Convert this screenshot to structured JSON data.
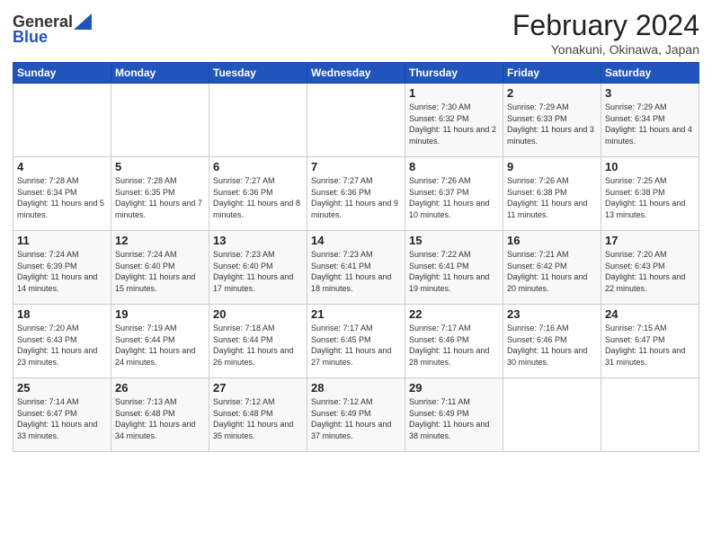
{
  "header": {
    "logo_general": "General",
    "logo_blue": "Blue",
    "title": "February 2024",
    "subtitle": "Yonakuni, Okinawa, Japan"
  },
  "weekdays": [
    "Sunday",
    "Monday",
    "Tuesday",
    "Wednesday",
    "Thursday",
    "Friday",
    "Saturday"
  ],
  "weeks": [
    [
      {
        "day": "",
        "sunrise": "",
        "sunset": "",
        "daylight": ""
      },
      {
        "day": "",
        "sunrise": "",
        "sunset": "",
        "daylight": ""
      },
      {
        "day": "",
        "sunrise": "",
        "sunset": "",
        "daylight": ""
      },
      {
        "day": "",
        "sunrise": "",
        "sunset": "",
        "daylight": ""
      },
      {
        "day": "1",
        "sunrise": "Sunrise: 7:30 AM",
        "sunset": "Sunset: 6:32 PM",
        "daylight": "Daylight: 11 hours and 2 minutes."
      },
      {
        "day": "2",
        "sunrise": "Sunrise: 7:29 AM",
        "sunset": "Sunset: 6:33 PM",
        "daylight": "Daylight: 11 hours and 3 minutes."
      },
      {
        "day": "3",
        "sunrise": "Sunrise: 7:29 AM",
        "sunset": "Sunset: 6:34 PM",
        "daylight": "Daylight: 11 hours and 4 minutes."
      }
    ],
    [
      {
        "day": "4",
        "sunrise": "Sunrise: 7:28 AM",
        "sunset": "Sunset: 6:34 PM",
        "daylight": "Daylight: 11 hours and 5 minutes."
      },
      {
        "day": "5",
        "sunrise": "Sunrise: 7:28 AM",
        "sunset": "Sunset: 6:35 PM",
        "daylight": "Daylight: 11 hours and 7 minutes."
      },
      {
        "day": "6",
        "sunrise": "Sunrise: 7:27 AM",
        "sunset": "Sunset: 6:36 PM",
        "daylight": "Daylight: 11 hours and 8 minutes."
      },
      {
        "day": "7",
        "sunrise": "Sunrise: 7:27 AM",
        "sunset": "Sunset: 6:36 PM",
        "daylight": "Daylight: 11 hours and 9 minutes."
      },
      {
        "day": "8",
        "sunrise": "Sunrise: 7:26 AM",
        "sunset": "Sunset: 6:37 PM",
        "daylight": "Daylight: 11 hours and 10 minutes."
      },
      {
        "day": "9",
        "sunrise": "Sunrise: 7:26 AM",
        "sunset": "Sunset: 6:38 PM",
        "daylight": "Daylight: 11 hours and 11 minutes."
      },
      {
        "day": "10",
        "sunrise": "Sunrise: 7:25 AM",
        "sunset": "Sunset: 6:38 PM",
        "daylight": "Daylight: 11 hours and 13 minutes."
      }
    ],
    [
      {
        "day": "11",
        "sunrise": "Sunrise: 7:24 AM",
        "sunset": "Sunset: 6:39 PM",
        "daylight": "Daylight: 11 hours and 14 minutes."
      },
      {
        "day": "12",
        "sunrise": "Sunrise: 7:24 AM",
        "sunset": "Sunset: 6:40 PM",
        "daylight": "Daylight: 11 hours and 15 minutes."
      },
      {
        "day": "13",
        "sunrise": "Sunrise: 7:23 AM",
        "sunset": "Sunset: 6:40 PM",
        "daylight": "Daylight: 11 hours and 17 minutes."
      },
      {
        "day": "14",
        "sunrise": "Sunrise: 7:23 AM",
        "sunset": "Sunset: 6:41 PM",
        "daylight": "Daylight: 11 hours and 18 minutes."
      },
      {
        "day": "15",
        "sunrise": "Sunrise: 7:22 AM",
        "sunset": "Sunset: 6:41 PM",
        "daylight": "Daylight: 11 hours and 19 minutes."
      },
      {
        "day": "16",
        "sunrise": "Sunrise: 7:21 AM",
        "sunset": "Sunset: 6:42 PM",
        "daylight": "Daylight: 11 hours and 20 minutes."
      },
      {
        "day": "17",
        "sunrise": "Sunrise: 7:20 AM",
        "sunset": "Sunset: 6:43 PM",
        "daylight": "Daylight: 11 hours and 22 minutes."
      }
    ],
    [
      {
        "day": "18",
        "sunrise": "Sunrise: 7:20 AM",
        "sunset": "Sunset: 6:43 PM",
        "daylight": "Daylight: 11 hours and 23 minutes."
      },
      {
        "day": "19",
        "sunrise": "Sunrise: 7:19 AM",
        "sunset": "Sunset: 6:44 PM",
        "daylight": "Daylight: 11 hours and 24 minutes."
      },
      {
        "day": "20",
        "sunrise": "Sunrise: 7:18 AM",
        "sunset": "Sunset: 6:44 PM",
        "daylight": "Daylight: 11 hours and 26 minutes."
      },
      {
        "day": "21",
        "sunrise": "Sunrise: 7:17 AM",
        "sunset": "Sunset: 6:45 PM",
        "daylight": "Daylight: 11 hours and 27 minutes."
      },
      {
        "day": "22",
        "sunrise": "Sunrise: 7:17 AM",
        "sunset": "Sunset: 6:46 PM",
        "daylight": "Daylight: 11 hours and 28 minutes."
      },
      {
        "day": "23",
        "sunrise": "Sunrise: 7:16 AM",
        "sunset": "Sunset: 6:46 PM",
        "daylight": "Daylight: 11 hours and 30 minutes."
      },
      {
        "day": "24",
        "sunrise": "Sunrise: 7:15 AM",
        "sunset": "Sunset: 6:47 PM",
        "daylight": "Daylight: 11 hours and 31 minutes."
      }
    ],
    [
      {
        "day": "25",
        "sunrise": "Sunrise: 7:14 AM",
        "sunset": "Sunset: 6:47 PM",
        "daylight": "Daylight: 11 hours and 33 minutes."
      },
      {
        "day": "26",
        "sunrise": "Sunrise: 7:13 AM",
        "sunset": "Sunset: 6:48 PM",
        "daylight": "Daylight: 11 hours and 34 minutes."
      },
      {
        "day": "27",
        "sunrise": "Sunrise: 7:12 AM",
        "sunset": "Sunset: 6:48 PM",
        "daylight": "Daylight: 11 hours and 35 minutes."
      },
      {
        "day": "28",
        "sunrise": "Sunrise: 7:12 AM",
        "sunset": "Sunset: 6:49 PM",
        "daylight": "Daylight: 11 hours and 37 minutes."
      },
      {
        "day": "29",
        "sunrise": "Sunrise: 7:11 AM",
        "sunset": "Sunset: 6:49 PM",
        "daylight": "Daylight: 11 hours and 38 minutes."
      },
      {
        "day": "",
        "sunrise": "",
        "sunset": "",
        "daylight": ""
      },
      {
        "day": "",
        "sunrise": "",
        "sunset": "",
        "daylight": ""
      }
    ]
  ]
}
